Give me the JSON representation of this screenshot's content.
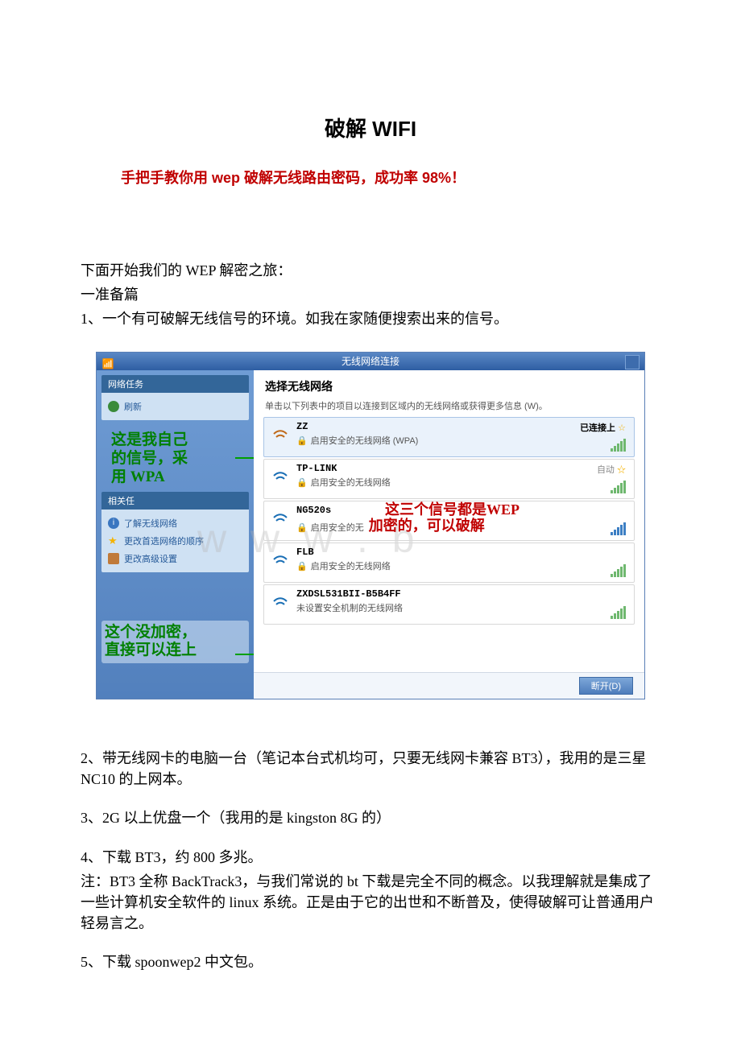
{
  "title": "破解 WIFI",
  "subtitle": "手把手教你用 wep 破解无线路由密码，成功率 98%！",
  "intro": {
    "l1": "下面开始我们的 WEP 解密之旅：",
    "l2": "一准备篇",
    "l3": "1、一个有可破解无线信号的环境。如我在家随便搜索出来的信号。"
  },
  "xp": {
    "titlebar": "无线网络连接",
    "sidebar": {
      "tasks_head": "网络任务",
      "refresh": "刷新",
      "annot_own_1": "这是我自己",
      "annot_own_2": "的信号，采",
      "annot_own_3": "用 WPA",
      "rel_head": "相关任",
      "learn": "了解无线网络",
      "reorder": "更改首选网络的顺序",
      "advanced": "更改高级设置",
      "annot_open_1": "这个没加密，",
      "annot_open_2": "直接可以连上"
    },
    "main": {
      "heading": "选择无线网络",
      "sub": "单击以下列表中的项目以连接到区域内的无线网络或获得更多信息 (W)。"
    },
    "networks": [
      {
        "ssid": "ZZ",
        "sec": "启用安全的无线网络 (WPA)",
        "status": "已连接上",
        "star": true,
        "selected": true
      },
      {
        "ssid": "TP-LINK",
        "sec": "启用安全的无线网络",
        "status": "自动",
        "star": true
      },
      {
        "ssid": "NG520s",
        "sec": "启用安全的无线网络加密的，可以破解"
      },
      {
        "ssid": "FLB",
        "sec": "启用安全的无线网络"
      },
      {
        "ssid": "ZXDSL531BII-B5B4FF",
        "sec": "未设置安全机制的无线网络",
        "open": true
      }
    ],
    "annot_wep_1": "这三个信号都是WEP",
    "annot_wep_2": "加密的，可以破解",
    "foot_btn": "断开(D)"
  },
  "paras": {
    "p2": "2、带无线网卡的电脑一台（笔记本台式机均可，只要无线网卡兼容 BT3），我用的是三星 NC10 的上网本。",
    "p3": "3、2G 以上优盘一个（我用的是 kingston 8G 的）",
    "p4a": "4、下载 BT3，约 800 多兆。",
    "p4b": "注：BT3 全称 BackTrack3，与我们常说的 bt 下载是完全不同的概念。以我理解就是集成了一些计算机安全软件的 linux 系统。正是由于它的出世和不断普及，使得破解可让普通用户轻易言之。",
    "p5": "5、下载 spoonwep2 中文包。"
  }
}
